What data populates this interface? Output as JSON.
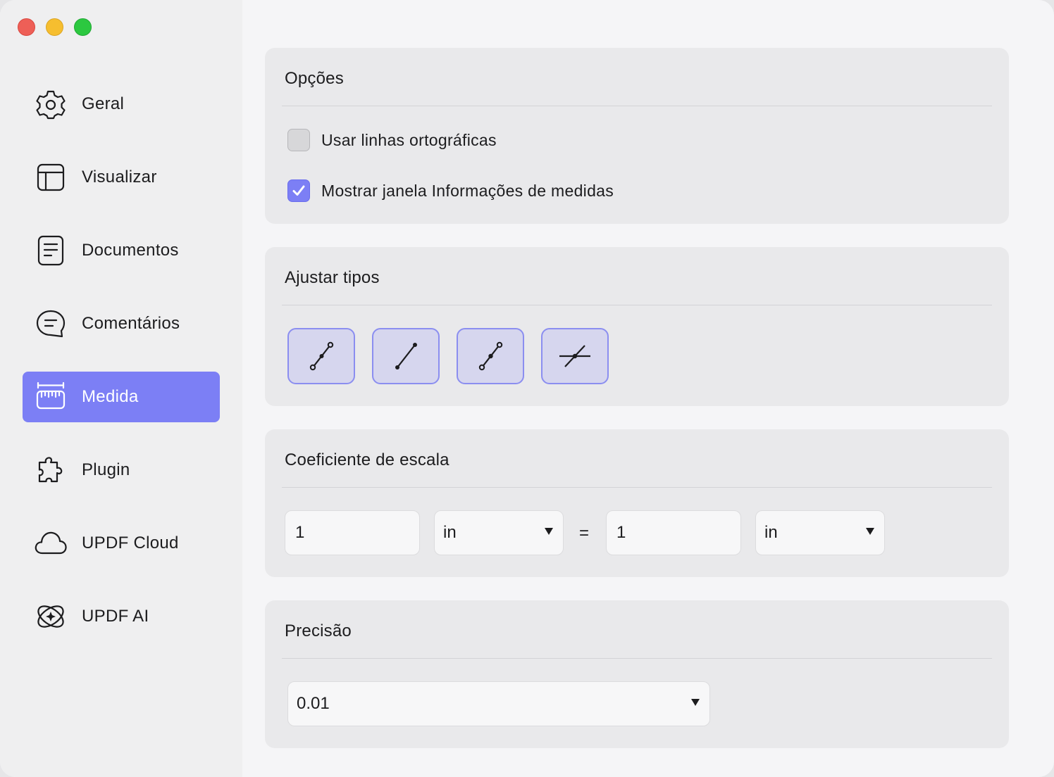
{
  "sidebar": {
    "items": [
      {
        "label": "Geral",
        "icon": "gear-icon"
      },
      {
        "label": "Visualizar",
        "icon": "layout-icon"
      },
      {
        "label": "Documentos",
        "icon": "document-icon"
      },
      {
        "label": "Comentários",
        "icon": "comment-icon"
      },
      {
        "label": "Medida",
        "icon": "ruler-icon",
        "active": true
      },
      {
        "label": "Plugin",
        "icon": "puzzle-icon"
      },
      {
        "label": "UPDF Cloud",
        "icon": "cloud-icon"
      },
      {
        "label": "UPDF AI",
        "icon": "ai-icon"
      }
    ]
  },
  "options": {
    "title": "Opções",
    "orthographic": {
      "label": "Usar linhas ortográficas",
      "checked": false
    },
    "show_info": {
      "label": "Mostrar janela Informações de medidas",
      "checked": true
    }
  },
  "snap": {
    "title": "Ajustar tipos",
    "buttons": [
      "snap-endpoint-icon",
      "snap-path-icon",
      "snap-midpoint-icon",
      "snap-intersection-icon"
    ]
  },
  "scale": {
    "title": "Coeficiente de escala",
    "left_value": "1",
    "left_unit": "in",
    "equals": "=",
    "right_value": "1",
    "right_unit": "in"
  },
  "precision": {
    "title": "Precisão",
    "value": "0.01"
  },
  "colors": {
    "accent": "#7c7ff5",
    "snap_bg": "#d6d6ee"
  }
}
